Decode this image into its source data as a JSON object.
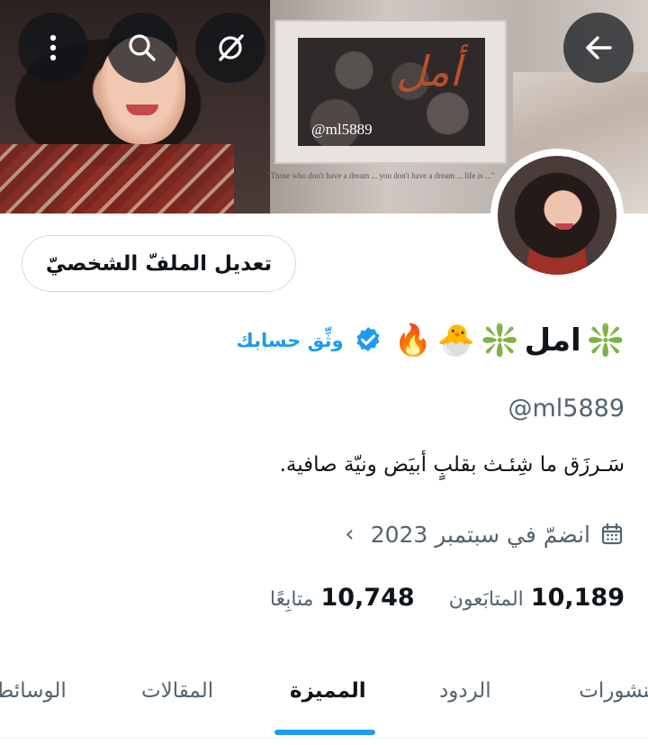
{
  "banner": {
    "arabic_text": "أمل",
    "handle_text": "@ml5889",
    "note_text": "\"Those who don't have a dream ... you don't have a dream ... life is ...\""
  },
  "top_bar": {
    "more_icon": "more-vertical-icon",
    "search_icon": "search-icon",
    "grok_icon": "grok-icon",
    "back_icon": "arrow-left-icon"
  },
  "profile": {
    "edit_button_label": "تعديل الملفّ الشخصيّ",
    "display_name": "امل",
    "name_emojis": [
      "❇️",
      "🐣",
      "🔥"
    ],
    "leading_emoji": "❇️",
    "verify_link": "وثِّق حسابك",
    "verified_color": "#1d9bf0",
    "handle": "@ml5889",
    "bio": "سَـرزَق ما شِئـث بقلبٍ أبيَض ونيّة صافية.",
    "joined_text": "انضمّ في سبتمبر 2023",
    "chevron": "‹"
  },
  "stats": {
    "followers_count": "10,189",
    "followers_label": "المتابَعون",
    "following_count": "10,748",
    "following_label": "متابِعًا"
  },
  "tabs": {
    "posts": "منشورات",
    "replies": "الردود",
    "highlights": "المميزة",
    "articles": "المقالات",
    "media": "الوسائط",
    "active": "المميزة"
  },
  "colors": {
    "accent": "#1d9bf0",
    "text_primary": "#0f1419",
    "text_secondary": "#536471"
  }
}
